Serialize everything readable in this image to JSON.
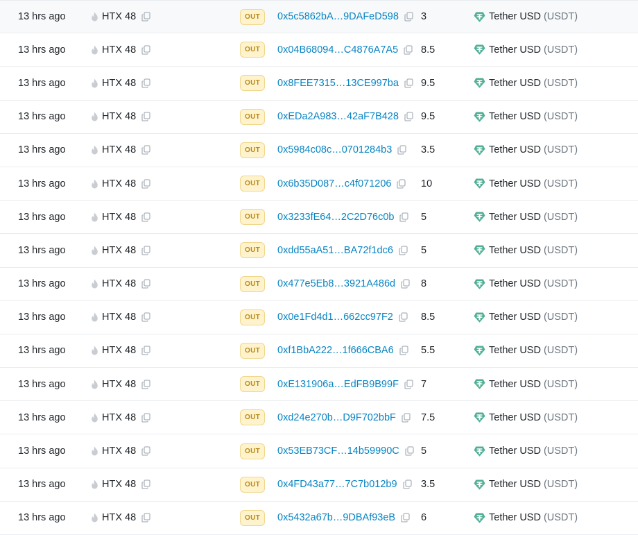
{
  "colors": {
    "link": "#0784c3",
    "badge_bg": "#fff3cd",
    "badge_border": "#f0d68a",
    "badge_text": "#b58a1a",
    "tether_green": "#50af95",
    "muted": "#6c757d"
  },
  "icons": {
    "from": "flame-icon",
    "copy": "copy-icon",
    "token": "tether-icon"
  },
  "rows": [
    {
      "age": "13 hrs ago",
      "from": "HTX 48",
      "direction": "OUT",
      "to": "0x5c5862bA…9DAFeD598",
      "quantity": "3",
      "token_name": "Tether USD",
      "token_symbol": "(USDT)"
    },
    {
      "age": "13 hrs ago",
      "from": "HTX 48",
      "direction": "OUT",
      "to": "0x04B68094…C4876A7A5",
      "quantity": "8.5",
      "token_name": "Tether USD",
      "token_symbol": "(USDT)"
    },
    {
      "age": "13 hrs ago",
      "from": "HTX 48",
      "direction": "OUT",
      "to": "0x8FEE7315…13CE997ba",
      "quantity": "9.5",
      "token_name": "Tether USD",
      "token_symbol": "(USDT)"
    },
    {
      "age": "13 hrs ago",
      "from": "HTX 48",
      "direction": "OUT",
      "to": "0xEDa2A983…42aF7B428",
      "quantity": "9.5",
      "token_name": "Tether USD",
      "token_symbol": "(USDT)"
    },
    {
      "age": "13 hrs ago",
      "from": "HTX 48",
      "direction": "OUT",
      "to": "0x5984c08c…0701284b3",
      "quantity": "3.5",
      "token_name": "Tether USD",
      "token_symbol": "(USDT)"
    },
    {
      "age": "13 hrs ago",
      "from": "HTX 48",
      "direction": "OUT",
      "to": "0x6b35D087…c4f071206",
      "quantity": "10",
      "token_name": "Tether USD",
      "token_symbol": "(USDT)"
    },
    {
      "age": "13 hrs ago",
      "from": "HTX 48",
      "direction": "OUT",
      "to": "0x3233fE64…2C2D76c0b",
      "quantity": "5",
      "token_name": "Tether USD",
      "token_symbol": "(USDT)"
    },
    {
      "age": "13 hrs ago",
      "from": "HTX 48",
      "direction": "OUT",
      "to": "0xdd55aA51…BA72f1dc6",
      "quantity": "5",
      "token_name": "Tether USD",
      "token_symbol": "(USDT)"
    },
    {
      "age": "13 hrs ago",
      "from": "HTX 48",
      "direction": "OUT",
      "to": "0x477e5Eb8…3921A486d",
      "quantity": "8",
      "token_name": "Tether USD",
      "token_symbol": "(USDT)"
    },
    {
      "age": "13 hrs ago",
      "from": "HTX 48",
      "direction": "OUT",
      "to": "0x0e1Fd4d1…662cc97F2",
      "quantity": "8.5",
      "token_name": "Tether USD",
      "token_symbol": "(USDT)"
    },
    {
      "age": "13 hrs ago",
      "from": "HTX 48",
      "direction": "OUT",
      "to": "0xf1BbA222…1f666CBA6",
      "quantity": "5.5",
      "token_name": "Tether USD",
      "token_symbol": "(USDT)"
    },
    {
      "age": "13 hrs ago",
      "from": "HTX 48",
      "direction": "OUT",
      "to": "0xE131906a…EdFB9B99F",
      "quantity": "7",
      "token_name": "Tether USD",
      "token_symbol": "(USDT)"
    },
    {
      "age": "13 hrs ago",
      "from": "HTX 48",
      "direction": "OUT",
      "to": "0xd24e270b…D9F702bbF",
      "quantity": "7.5",
      "token_name": "Tether USD",
      "token_symbol": "(USDT)"
    },
    {
      "age": "13 hrs ago",
      "from": "HTX 48",
      "direction": "OUT",
      "to": "0x53EB73CF…14b59990C",
      "quantity": "5",
      "token_name": "Tether USD",
      "token_symbol": "(USDT)"
    },
    {
      "age": "13 hrs ago",
      "from": "HTX 48",
      "direction": "OUT",
      "to": "0x4FD43a77…7C7b012b9",
      "quantity": "3.5",
      "token_name": "Tether USD",
      "token_symbol": "(USDT)"
    },
    {
      "age": "13 hrs ago",
      "from": "HTX 48",
      "direction": "OUT",
      "to": "0x5432a67b…9DBAf93eB",
      "quantity": "6",
      "token_name": "Tether USD",
      "token_symbol": "(USDT)"
    }
  ]
}
